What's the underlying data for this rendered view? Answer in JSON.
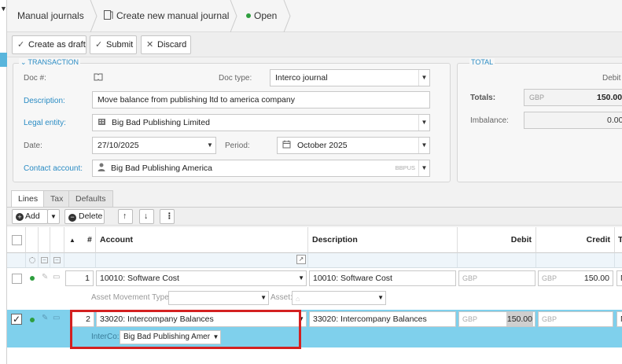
{
  "breadcrumb": {
    "journals": "Manual journals",
    "create": "Create new manual journal",
    "status": "Open"
  },
  "toolbar": {
    "draft": "Create as draft",
    "submit": "Submit",
    "discard": "Discard"
  },
  "transaction": {
    "title": "TRANSACTION",
    "doc_no_label": "Doc #:",
    "doc_type_label": "Doc type:",
    "doc_type": "Interco journal",
    "description_label": "Description:",
    "description": "Move balance from publishing ltd to america company",
    "legal_entity_label": "Legal entity:",
    "legal_entity": "Big Bad Publishing Limited",
    "date_label": "Date:",
    "date": "27/10/2025",
    "period_label": "Period:",
    "period": "October 2025",
    "contact_label": "Contact account:",
    "contact": "Big Bad Publishing America",
    "contact_code": "BBPUS"
  },
  "total": {
    "title": "TOTAL",
    "debit_header": "Debit",
    "totals_label": "Totals:",
    "currency": "GBP",
    "totals_value": "150.00",
    "imbalance_label": "Imbalance:",
    "imbalance_value": "0.00"
  },
  "tabs": [
    "Lines",
    "Tax",
    "Defaults"
  ],
  "lines_toolbar": {
    "add": "Add",
    "delete": "Delete"
  },
  "grid": {
    "headers": {
      "sort": "▲",
      "num": "#",
      "account": "Account",
      "description": "Description",
      "debit": "Debit",
      "credit": "Credit",
      "t": "T"
    },
    "rows": [
      {
        "num": "1",
        "account": "10010: Software Cost",
        "description": "10010: Software Cost",
        "debit_currency": "GBP",
        "credit_currency": "GBP",
        "credit": "150.00",
        "t": "N",
        "sub_label_1": "Asset Movement Type:",
        "sub_label_2": "Asset:"
      },
      {
        "num": "2",
        "account": "33020: Intercompany Balances",
        "description": "33020: Intercompany Balances",
        "debit_currency": "GBP",
        "debit": "150.00",
        "credit_currency": "GBP",
        "t": "N",
        "interco_label": "InterCo:",
        "interco": "Big Bad Publishing Amer"
      }
    ]
  },
  "colors": {
    "accent": "#2b8cc4",
    "status_green": "#2e9e3e",
    "selected_row": "#7fd0ec",
    "highlight_box": "#d42020"
  }
}
